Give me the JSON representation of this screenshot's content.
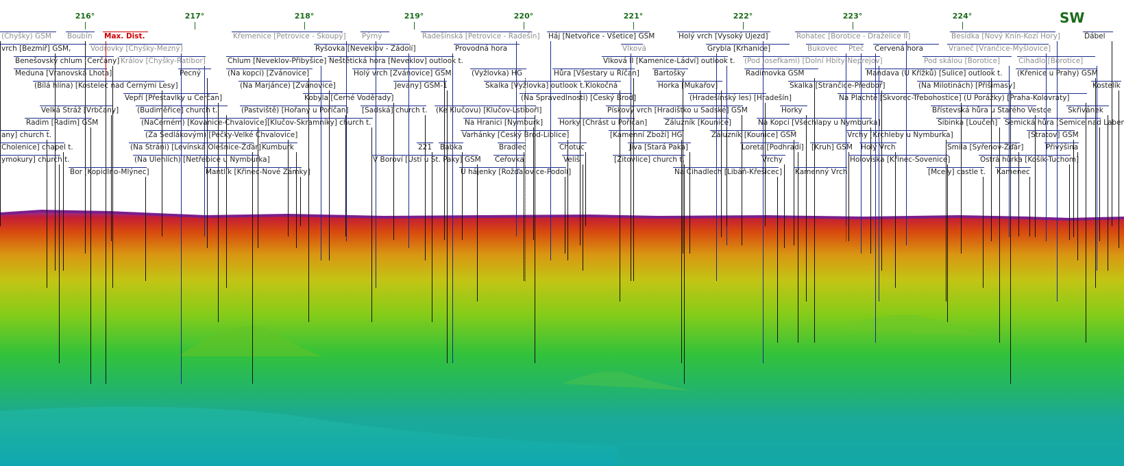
{
  "compass": "SW",
  "ticks": [
    "216°",
    "217°",
    "218°",
    "219°",
    "220°",
    "221°",
    "222°",
    "223°",
    "224°"
  ],
  "colors": {
    "tick": "#1a6b1a",
    "leader": "#111111",
    "max_dist": "#cc0000"
  },
  "peaks": [
    {
      "label": "(Chyšky) GSM",
      "style": "dim"
    },
    {
      "label": "Boubín",
      "style": "dim"
    },
    {
      "label": "Max. Dist.",
      "style": "red"
    },
    {
      "label": "Křemenice [Petrovice - Skoupý]",
      "style": "dim"
    },
    {
      "label": "Pýrný",
      "style": "dim"
    },
    {
      "label": "Radešínská [Petrovice - Radešín]",
      "style": "dim"
    },
    {
      "label": "Háj [Netvořice - Všetice] GSM",
      "style": "normal"
    },
    {
      "label": "Holý vrch [Vysoký Újezd]",
      "style": "normal"
    },
    {
      "label": "Rohatec [Borotice - Draželice II]",
      "style": "dim"
    },
    {
      "label": "Besídka [Nový Knín-Kozí Hory]",
      "style": "dim"
    },
    {
      "label": "Ďábel",
      "style": "normal"
    },
    {
      "label": "vrch [Bezmíř] GSM,",
      "style": "normal"
    },
    {
      "label": "Vodrovky [Chyšky-Mezný]",
      "style": "dim"
    },
    {
      "label": "Ryšovka [Neveklov - Zádolí]",
      "style": "normal"
    },
    {
      "label": "Provodná hora",
      "style": "normal"
    },
    {
      "label": "Vlková",
      "style": "dim"
    },
    {
      "label": "Grybla [Krhanice]",
      "style": "normal"
    },
    {
      "label": "Bukovec",
      "style": "dim"
    },
    {
      "label": "Pteč",
      "style": "dim"
    },
    {
      "label": "Červená hora",
      "style": "normal"
    },
    {
      "label": "Vraneč [Vrančice-Myšlovice]",
      "style": "dim"
    },
    {
      "label": "Benešovský chlum [Cerčany]",
      "style": "normal"
    },
    {
      "label": "Králov [Chyšky-Ratibor]",
      "style": "dim"
    },
    {
      "label": "Chlum [Neveklov-Přibyšice]",
      "style": "normal"
    },
    {
      "label": "Neštětická hora [Neveklov] outlook t.",
      "style": "normal"
    },
    {
      "label": "Vlková II [Kamenice-Ládví] outlook t.",
      "style": "normal"
    },
    {
      "label": "(Pod Josefkami) [Dolní Hbity-Neprejov]",
      "style": "dim"
    },
    {
      "label": "Pod skálou [Borotice]",
      "style": "dim"
    },
    {
      "label": "Čihadlo [Borotice]",
      "style": "dim"
    },
    {
      "label": "Meduna [Vranovská Lhota]",
      "style": "normal"
    },
    {
      "label": "Pecný",
      "style": "normal"
    },
    {
      "label": "(Na kopci) [Zvánovice]",
      "style": "normal"
    },
    {
      "label": "Holý vrch [Zvánovice] GSM",
      "style": "normal"
    },
    {
      "label": "(Vyžlovka) HG",
      "style": "normal"
    },
    {
      "label": "Hůra [Všestary u Říčan]",
      "style": "normal"
    },
    {
      "label": "Bartošky",
      "style": "normal"
    },
    {
      "label": "Radimovka GSM",
      "style": "normal"
    },
    {
      "label": "Mandava (U Křížků) [Sulice] outlook t.",
      "style": "normal"
    },
    {
      "label": "(Křenice u Prahy) GSM",
      "style": "normal"
    },
    {
      "label": "(Bílá hlína) [Kostelec nad Černými Lesy]",
      "style": "normal"
    },
    {
      "label": "(Na Marjánce) [Zvánovice]",
      "style": "normal"
    },
    {
      "label": "Jevany] GSM-1",
      "style": "normal"
    },
    {
      "label": "Skalka [Vyžlovka] outlook t.",
      "style": "normal"
    },
    {
      "label": "Klokočná",
      "style": "normal"
    },
    {
      "label": "Horka [Mukařov]",
      "style": "normal"
    },
    {
      "label": "Skalka [Strančice-Předboř]",
      "style": "normal"
    },
    {
      "label": "(Na Milotinách) [Přišimasy]",
      "style": "normal"
    },
    {
      "label": "Kostelík",
      "style": "normal"
    },
    {
      "label": "Vepří [Přestavlky u Cerčan]",
      "style": "normal"
    },
    {
      "label": "Kobyla [Černé Voděrady]",
      "style": "normal"
    },
    {
      "label": "(Na Spravedlnosti) [Český Brod]",
      "style": "normal"
    },
    {
      "label": "(Hradešínský les) [Hradešín]",
      "style": "normal"
    },
    {
      "label": "Na Plachtě [Skvorec-Třebohostice]",
      "style": "normal"
    },
    {
      "label": "(U Porážky) [Praha-Kolovraty]",
      "style": "normal"
    },
    {
      "label": "Velká Stráž [Vrbčany]",
      "style": "normal"
    },
    {
      "label": "(Budiměřice] church t.",
      "style": "normal"
    },
    {
      "label": "(Pastviště) [Hořany u Poříčan]",
      "style": "normal"
    },
    {
      "label": "[Sadská] church t.",
      "style": "normal"
    },
    {
      "label": "(Ke Klučovu) [Klučov-Lstibořl]",
      "style": "normal"
    },
    {
      "label": "Pískový vrch [Hradištko u Sadské] GSM",
      "style": "normal"
    },
    {
      "label": "Horky",
      "style": "normal"
    },
    {
      "label": "Břístevská hůra u Starého Vestce",
      "style": "normal"
    },
    {
      "label": "Skřivánek",
      "style": "normal"
    },
    {
      "label": "Radim [Radim] GSM",
      "style": "normal"
    },
    {
      "label": "(NaČerném) [Kovanice-Chvalovice]",
      "style": "normal"
    },
    {
      "label": "[Klučov-Skramníky] church t.",
      "style": "normal"
    },
    {
      "label": "Na Hranici [Nymburk]",
      "style": "normal"
    },
    {
      "label": "Horky [Chrást u Poříčan]",
      "style": "normal"
    },
    {
      "label": "Záluzník [Kounice]",
      "style": "normal"
    },
    {
      "label": "Na Kopci [Všechlapy u Nymburka]",
      "style": "normal"
    },
    {
      "label": "Šibinka [Loučeň]",
      "style": "normal"
    },
    {
      "label": "Semická hůra [Semice nad Labem]",
      "style": "normal"
    },
    {
      "label": "any] church t.",
      "style": "normal"
    },
    {
      "label": "(Za Sedlákovým) [Pečky-Velké Chvalovice]",
      "style": "normal"
    },
    {
      "label": "Varhánky [Český Brod-Liblice]",
      "style": "normal"
    },
    {
      "label": "[Kamenní Zboží] HG",
      "style": "normal"
    },
    {
      "label": "Záluzník [Kounice] GSM",
      "style": "normal"
    },
    {
      "label": "Vrchy [Krchleby u Nymburka]",
      "style": "normal"
    },
    {
      "label": "[Stratov] GSM",
      "style": "normal"
    },
    {
      "label": "Cholenice] chapel t.",
      "style": "normal"
    },
    {
      "label": "(Na Stráni) [Levínská Olešnice-Žďár]",
      "style": "normal"
    },
    {
      "label": "Kumburk",
      "style": "normal"
    },
    {
      "label": "221",
      "style": "normal"
    },
    {
      "label": "Babka",
      "style": "normal"
    },
    {
      "label": "Bradlec",
      "style": "normal"
    },
    {
      "label": "Chotuc",
      "style": "normal"
    },
    {
      "label": "Jíva [Stará Paka]",
      "style": "normal"
    },
    {
      "label": "Loreta [Podhradí]",
      "style": "normal"
    },
    {
      "label": "[Kruh] GSM",
      "style": "normal"
    },
    {
      "label": "Holý Vrch",
      "style": "normal"
    },
    {
      "label": "Smila [Syřenov-Žďár]",
      "style": "normal"
    },
    {
      "label": "Přivýšina",
      "style": "normal"
    },
    {
      "label": "ymokury] church t.",
      "style": "normal"
    },
    {
      "label": "(Na Úlehlích) [Netřebice u Nymburka]",
      "style": "normal"
    },
    {
      "label": "V Boroví [Ústí u St. Paky] GSM",
      "style": "normal"
    },
    {
      "label": "Čeřovka",
      "style": "normal"
    },
    {
      "label": "Veliš",
      "style": "normal"
    },
    {
      "label": "[Žitovlice] church t.",
      "style": "normal"
    },
    {
      "label": "Vrchy",
      "style": "normal"
    },
    {
      "label": "Holoviska [Křinec-Sovenice]",
      "style": "normal"
    },
    {
      "label": "Ostrá hůrka [Košík-Tuchom]",
      "style": "normal"
    },
    {
      "label": "Bor [Kopidlno-Mlýnec]",
      "style": "normal"
    },
    {
      "label": "Mantlík [Křinec-Nové Zámky]",
      "style": "normal"
    },
    {
      "label": "U hájenky [Rožďalovice-Podolí]",
      "style": "normal"
    },
    {
      "label": "Na Čihadlech [Libáň-Křešicec]",
      "style": "normal"
    },
    {
      "label": "Kamenný Vrch",
      "style": "normal"
    },
    {
      "label": "[Mcely] castle t.",
      "style": "normal"
    },
    {
      "label": "Kamenec",
      "style": "normal"
    }
  ]
}
